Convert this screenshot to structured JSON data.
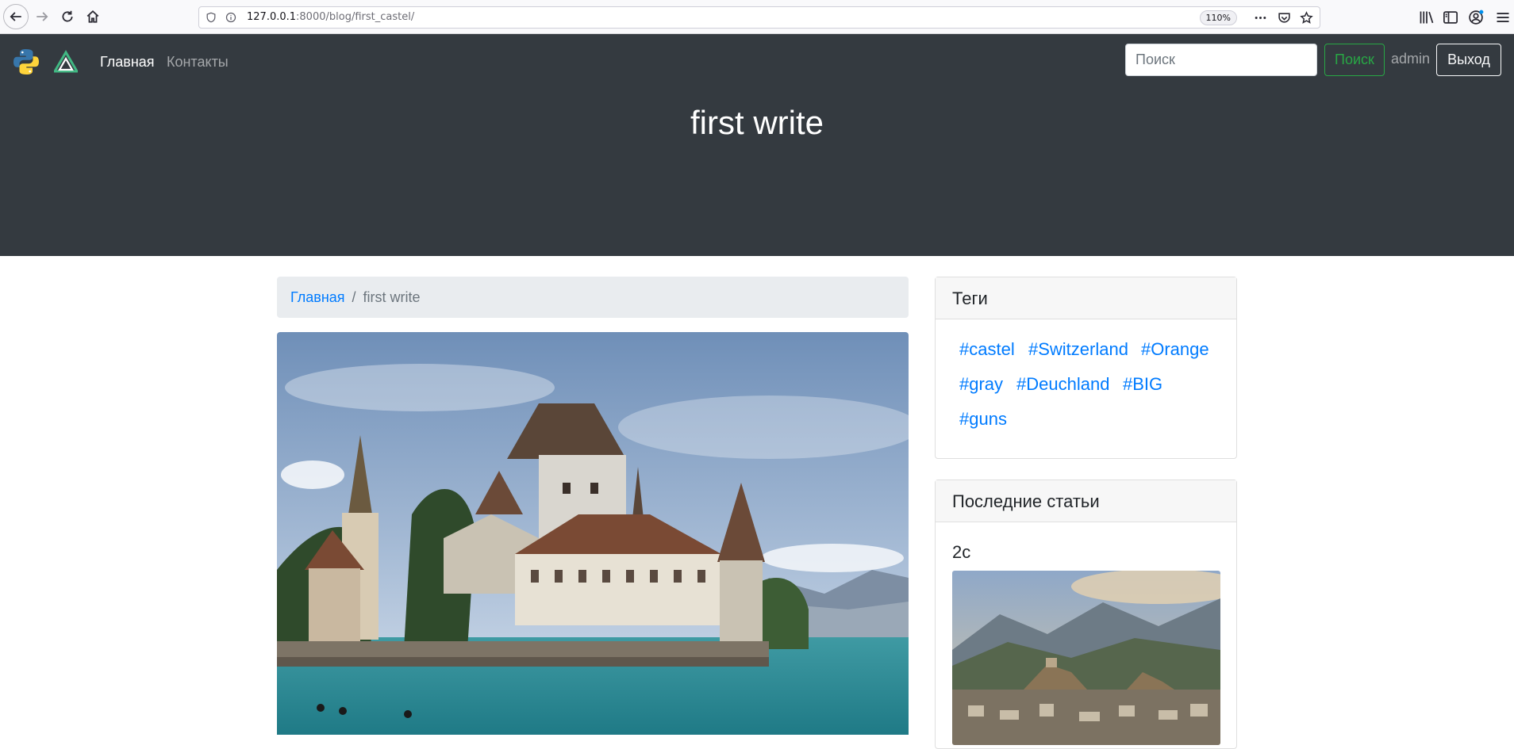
{
  "browser": {
    "url_host": "127.0.0.1",
    "url_rest": ":8000/blog/first_castel/",
    "zoom": "110%"
  },
  "navbar": {
    "home_label": "Главная",
    "contacts_label": "Контакты",
    "search_placeholder": "Поиск",
    "search_button": "Поиск",
    "username": "admin",
    "logout_button": "Выход",
    "hero_title": "first write"
  },
  "breadcrumb": {
    "home": "Главная",
    "separator": "/",
    "current": "first write"
  },
  "tags": {
    "title": "Теги",
    "items": [
      "#castel",
      "#Switzerland",
      "#Orange",
      "#gray",
      "#Deuchland",
      "#BIG",
      "#guns"
    ]
  },
  "recent": {
    "title": "Последние статьи",
    "post_title": "2c"
  },
  "colors": {
    "navbar_bg": "#343a40",
    "link": "#007bff",
    "success": "#28a745",
    "breadcrumb_bg": "#e9ecef"
  }
}
